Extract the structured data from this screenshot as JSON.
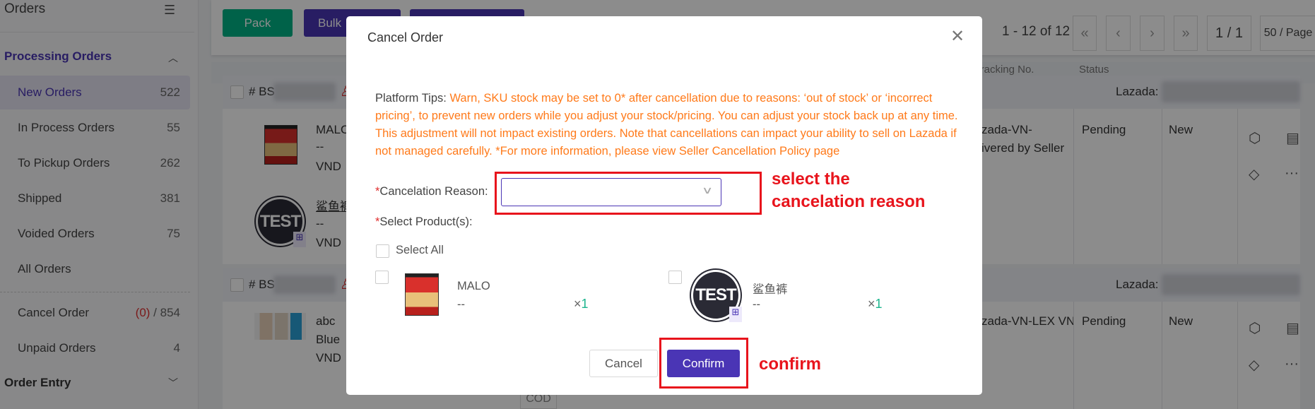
{
  "sidebar": {
    "title": "Orders",
    "groups": [
      {
        "label": "Processing Orders"
      },
      {
        "label": "Order Entry"
      }
    ],
    "items": [
      {
        "label": "New Orders",
        "count": "522"
      },
      {
        "label": "In Process Orders",
        "count": "55"
      },
      {
        "label": "To Pickup Orders",
        "count": "262"
      },
      {
        "label": "Shipped",
        "count": "381"
      },
      {
        "label": "Voided Orders",
        "count": "75"
      },
      {
        "label": "All Orders",
        "count": ""
      }
    ],
    "cancel": {
      "label": "Cancel Order",
      "pending": "(0)",
      "total": " / 854"
    },
    "unpaid": {
      "label": "Unpaid Orders",
      "count": "4"
    }
  },
  "toolbar": {
    "pack": "Pack",
    "bulk": "Bulk",
    "pagination": {
      "range": "1 - 12 of 12",
      "first": "«",
      "prev": "‹",
      "next": "›",
      "last": "»",
      "page": "1 / 1",
      "per_page": "50 / Page"
    }
  },
  "table": {
    "headers": [
      "Tracking No.",
      "Status"
    ]
  },
  "orders": [
    {
      "id_prefix": "# BS",
      "platform": "Lazada:",
      "products": [
        {
          "name": "MALO",
          "variant": "--",
          "price": "VND"
        },
        {
          "name": "鲨鱼裤",
          "variant": "--",
          "price": "VND"
        }
      ],
      "shipping": [
        "zada-VN-",
        "ivered by Seller"
      ],
      "status": "Pending",
      "state": "New"
    },
    {
      "id_prefix": "# BS",
      "platform": "Lazada:",
      "products": [
        {
          "name": "abc",
          "variant": "Blue",
          "price": "VND"
        }
      ],
      "shipping": [
        "zada-VN-LEX VN"
      ],
      "status": "Pending",
      "state": "New",
      "payment": "COD"
    }
  ],
  "modal": {
    "title": "Cancel Order",
    "tips_label": "Platform Tips: ",
    "tips_text": "Warn, SKU stock may be set to 0* after cancellation due to reasons: ‘out of stock’ or ‘incorrect pricing’, to prevent new orders while you adjust your stock/pricing. You can adjust your stock back up at any time. This adjustment will not impact existing orders. Note that cancellations can impact your ability to sell on Lazada if not managed carefully. *For more information, please view Seller Cancellation Policy page",
    "reason_label": "Cancelation Reason:",
    "reason_value": "",
    "products_label": "Select Product(s):",
    "select_all": "Select All",
    "products": [
      {
        "name": "MALO",
        "variant": "--",
        "qty_prefix": "×",
        "qty": "1"
      },
      {
        "name": "鲨鱼裤",
        "variant": "--",
        "qty_prefix": "×",
        "qty": "1"
      }
    ],
    "cancel": "Cancel",
    "confirm": "Confirm"
  },
  "annotations": {
    "reason": [
      "select the",
      "cancelation reason"
    ],
    "confirm": "confirm"
  },
  "colors": {
    "accent": "#4a35b5",
    "pack": "#00b386",
    "warning": "#ff7a1a",
    "annotation": "#e8141c"
  }
}
